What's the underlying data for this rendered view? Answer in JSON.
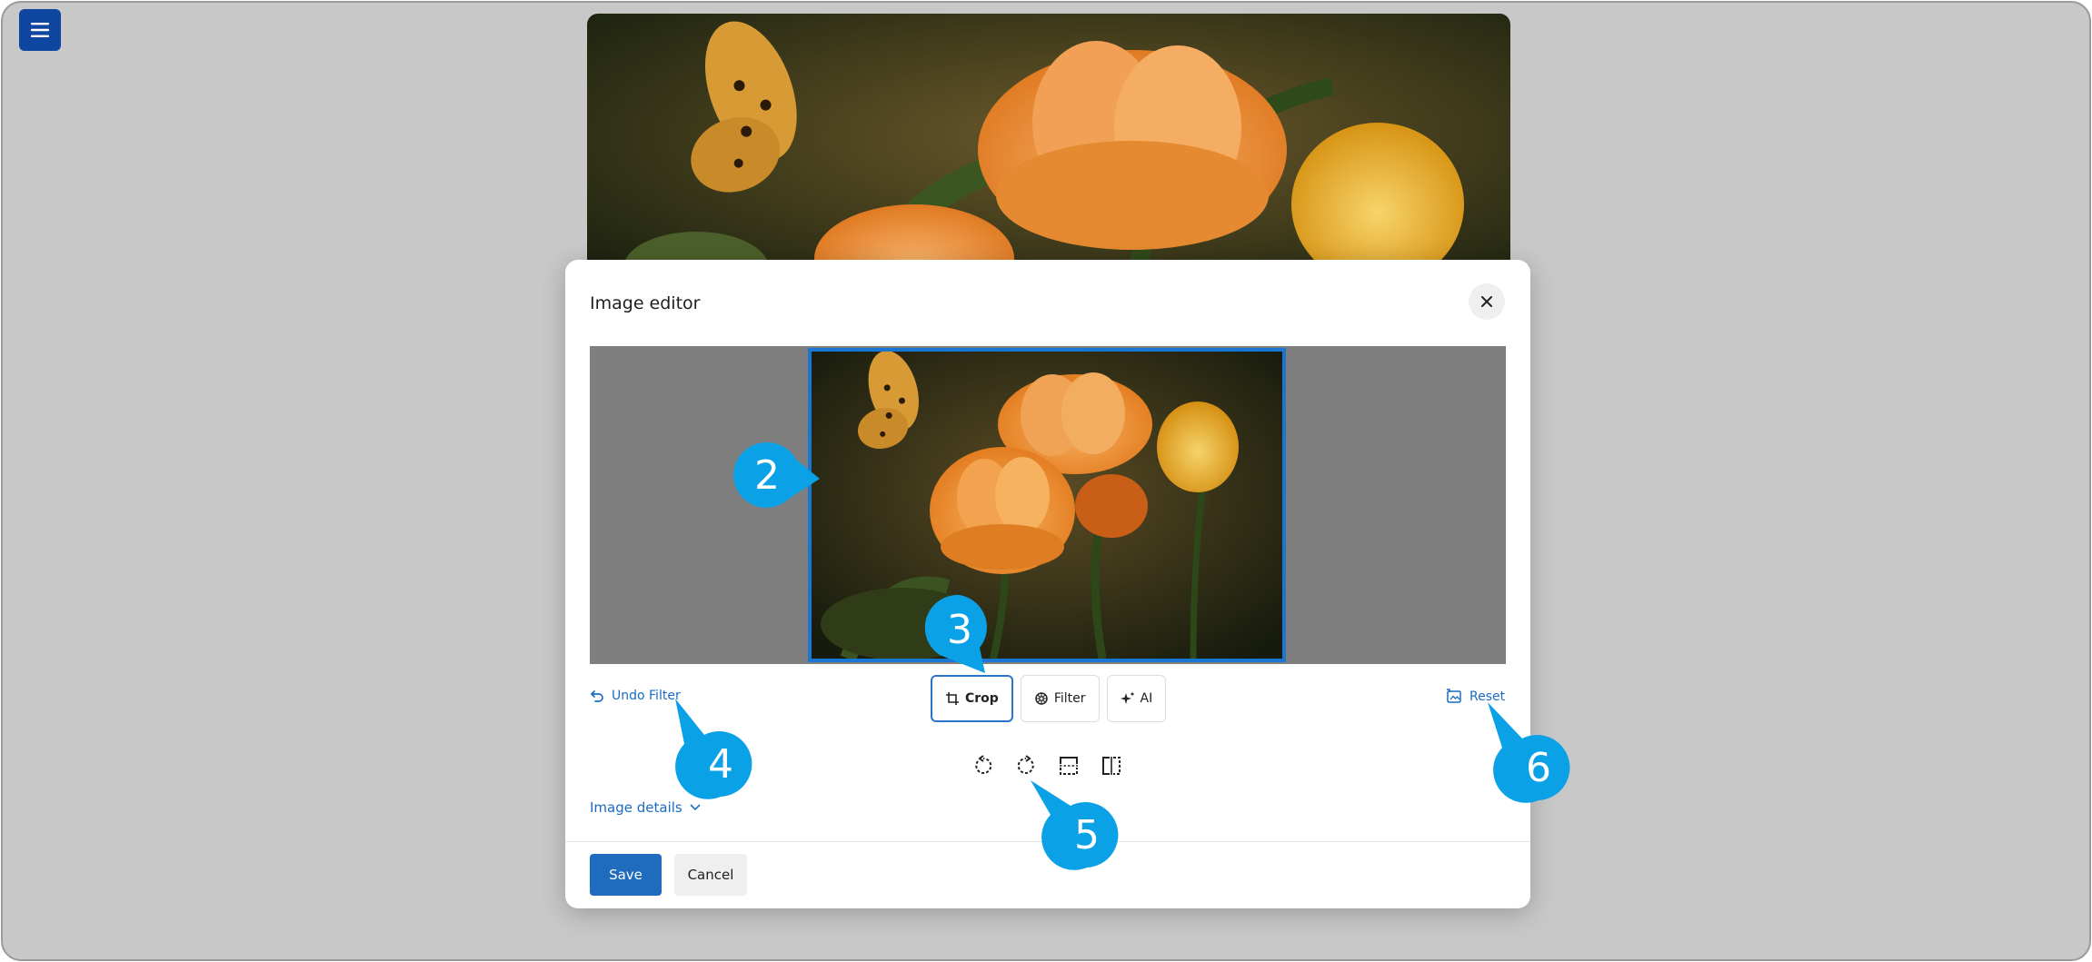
{
  "dialog": {
    "title": "Image editor",
    "close_icon": "close-icon"
  },
  "toolbar": {
    "undo_label": "Undo Filter",
    "reset_label": "Reset",
    "tabs": [
      {
        "label": "Crop",
        "icon": "crop-icon",
        "active": true
      },
      {
        "label": "Filter",
        "icon": "filter-icon",
        "active": false
      },
      {
        "label": "AI",
        "icon": "sparkle-icon",
        "active": false
      }
    ],
    "transform_icons": [
      "rotate-left-icon",
      "rotate-right-icon",
      "flip-vertical-icon",
      "flip-horizontal-icon"
    ]
  },
  "details": {
    "label": "Image details"
  },
  "footer": {
    "save_label": "Save",
    "cancel_label": "Cancel"
  },
  "callouts": [
    "2",
    "3",
    "4",
    "5",
    "6"
  ],
  "colors": {
    "accent": "#1f6bbe",
    "callout": "#0aa1e6",
    "menu": "#0f47a0"
  }
}
